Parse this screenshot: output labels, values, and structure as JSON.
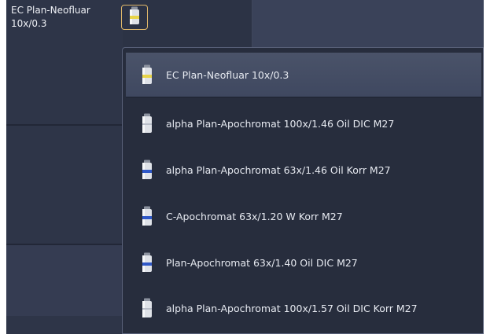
{
  "current_objective": {
    "label": "EC Plan-Neofluar 10x/0.3",
    "icon": "objective-icon-yellow-band"
  },
  "objective_button": {
    "icon": "objective-icon-yellow-band",
    "accent": "#e0b86a"
  },
  "dropdown": {
    "items": [
      {
        "label": "EC Plan-Neofluar 10x/0.3",
        "icon": "objective-icon-yellow-band",
        "band_color": "#e8d44a",
        "selected": true
      },
      {
        "label": "alpha Plan-Apochromat 100x/1.46 Oil DIC M27",
        "icon": "objective-icon-white",
        "band_color": "#d8dce4",
        "selected": false
      },
      {
        "label": "alpha Plan-Apochromat 63x/1.46 Oil Korr M27",
        "icon": "objective-icon-blue-band",
        "band_color": "#2f58c8",
        "selected": false
      },
      {
        "label": "C-Apochromat 63x/1.20 W Korr M27",
        "icon": "objective-icon-blue-band",
        "band_color": "#2f58c8",
        "selected": false
      },
      {
        "label": "Plan-Apochromat 63x/1.40 Oil DIC M27",
        "icon": "objective-icon-blue-band",
        "band_color": "#2f58c8",
        "selected": false
      },
      {
        "label": "alpha Plan-Apochromat 100x/1.57 Oil DIC Korr M27",
        "icon": "objective-icon-white",
        "band_color": "#d8dce4",
        "selected": false
      }
    ]
  },
  "colors": {
    "panel_bg": "#2e3548",
    "menu_bg": "#272d3d",
    "selected_bg": "#4a5369",
    "text": "#e7eaf1"
  }
}
